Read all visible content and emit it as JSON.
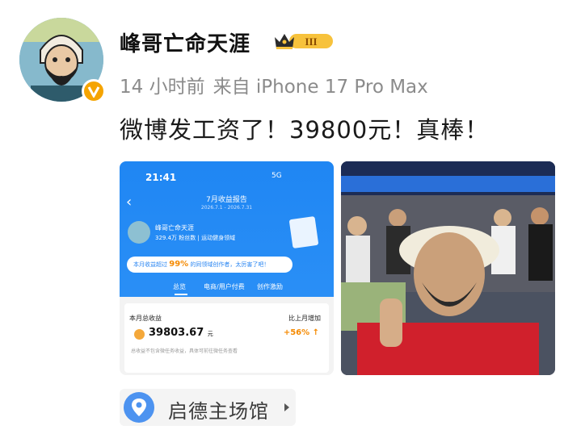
{
  "user": {
    "name": "峰哥亡命天涯",
    "badge_level": "III"
  },
  "meta": {
    "time": "14 小时前",
    "source": "来自 iPhone 17 Pro Max"
  },
  "post": {
    "text": "微博发工资了！39800元！真棒！"
  },
  "screenshot": {
    "time": "21:41",
    "status": "5G",
    "report_title": "7月收益报告",
    "report_dates": "2026.7.1 - 2026.7.31",
    "name": "峰哥亡命天涯",
    "followers": "329.4万",
    "followers_label": "粉丝数",
    "category": "运动健身",
    "category_suffix": "领域",
    "bubble_prefix": "本月收益超过",
    "bubble_pct": "99%",
    "bubble_suffix": "的同领域创作者，太厉害了吧！",
    "tabs": [
      "总览",
      "电商/用户付费",
      "创作激励"
    ],
    "total_label": "本月总收益",
    "compare_label": "比上月增加",
    "amount": "39803.67",
    "amount_unit": "元",
    "increase": "+56% ↑",
    "note": "总收益不包含微任务收益，具体可前往微任务查看"
  },
  "location": {
    "name": "启德主场馆"
  },
  "colors": {
    "accent": "#1f86f3",
    "verify": "#f5a400",
    "location_pin": "#4d93f0",
    "increase": "#f58a00"
  },
  "icons": {
    "verify": "verified-v-icon",
    "badge": "crown-badge-icon",
    "location": "location-pin-icon",
    "chevron": "chevron-right-icon"
  }
}
